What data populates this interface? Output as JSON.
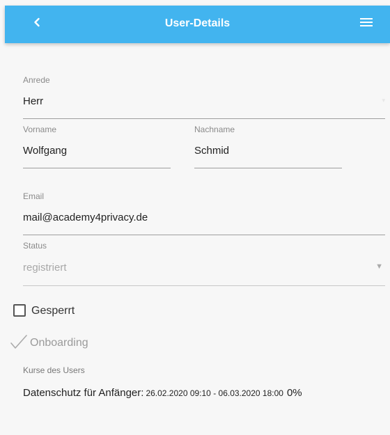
{
  "header": {
    "title": "User-Details"
  },
  "form": {
    "anrede": {
      "label": "Anrede",
      "value": "Herr"
    },
    "vorname": {
      "label": "Vorname",
      "value": "Wolfgang"
    },
    "nachname": {
      "label": "Nachname",
      "value": "Schmid"
    },
    "email": {
      "label": "Email",
      "value": "mail@academy4privacy.de"
    },
    "status": {
      "label": "Status",
      "value": "registriert"
    },
    "gesperrt": {
      "label": "Gesperrt",
      "checked": false
    },
    "onboarding": {
      "label": "Onboarding",
      "checked": true
    }
  },
  "courses": {
    "label": "Kurse des Users",
    "items": [
      {
        "name": "Datenschutz für Anfänger:",
        "dates": "26.02.2020 09:10 - 06.03.2020 18:00",
        "progress": "0%"
      }
    ]
  },
  "icons": {
    "back": "chevron-left-icon",
    "menu": "hamburger-menu-icon",
    "status_dropdown": "caret-down-icon",
    "onboarding": "check-icon"
  },
  "colors": {
    "header_bg": "#42b4ef",
    "page_bg": "#f7f7f7"
  }
}
